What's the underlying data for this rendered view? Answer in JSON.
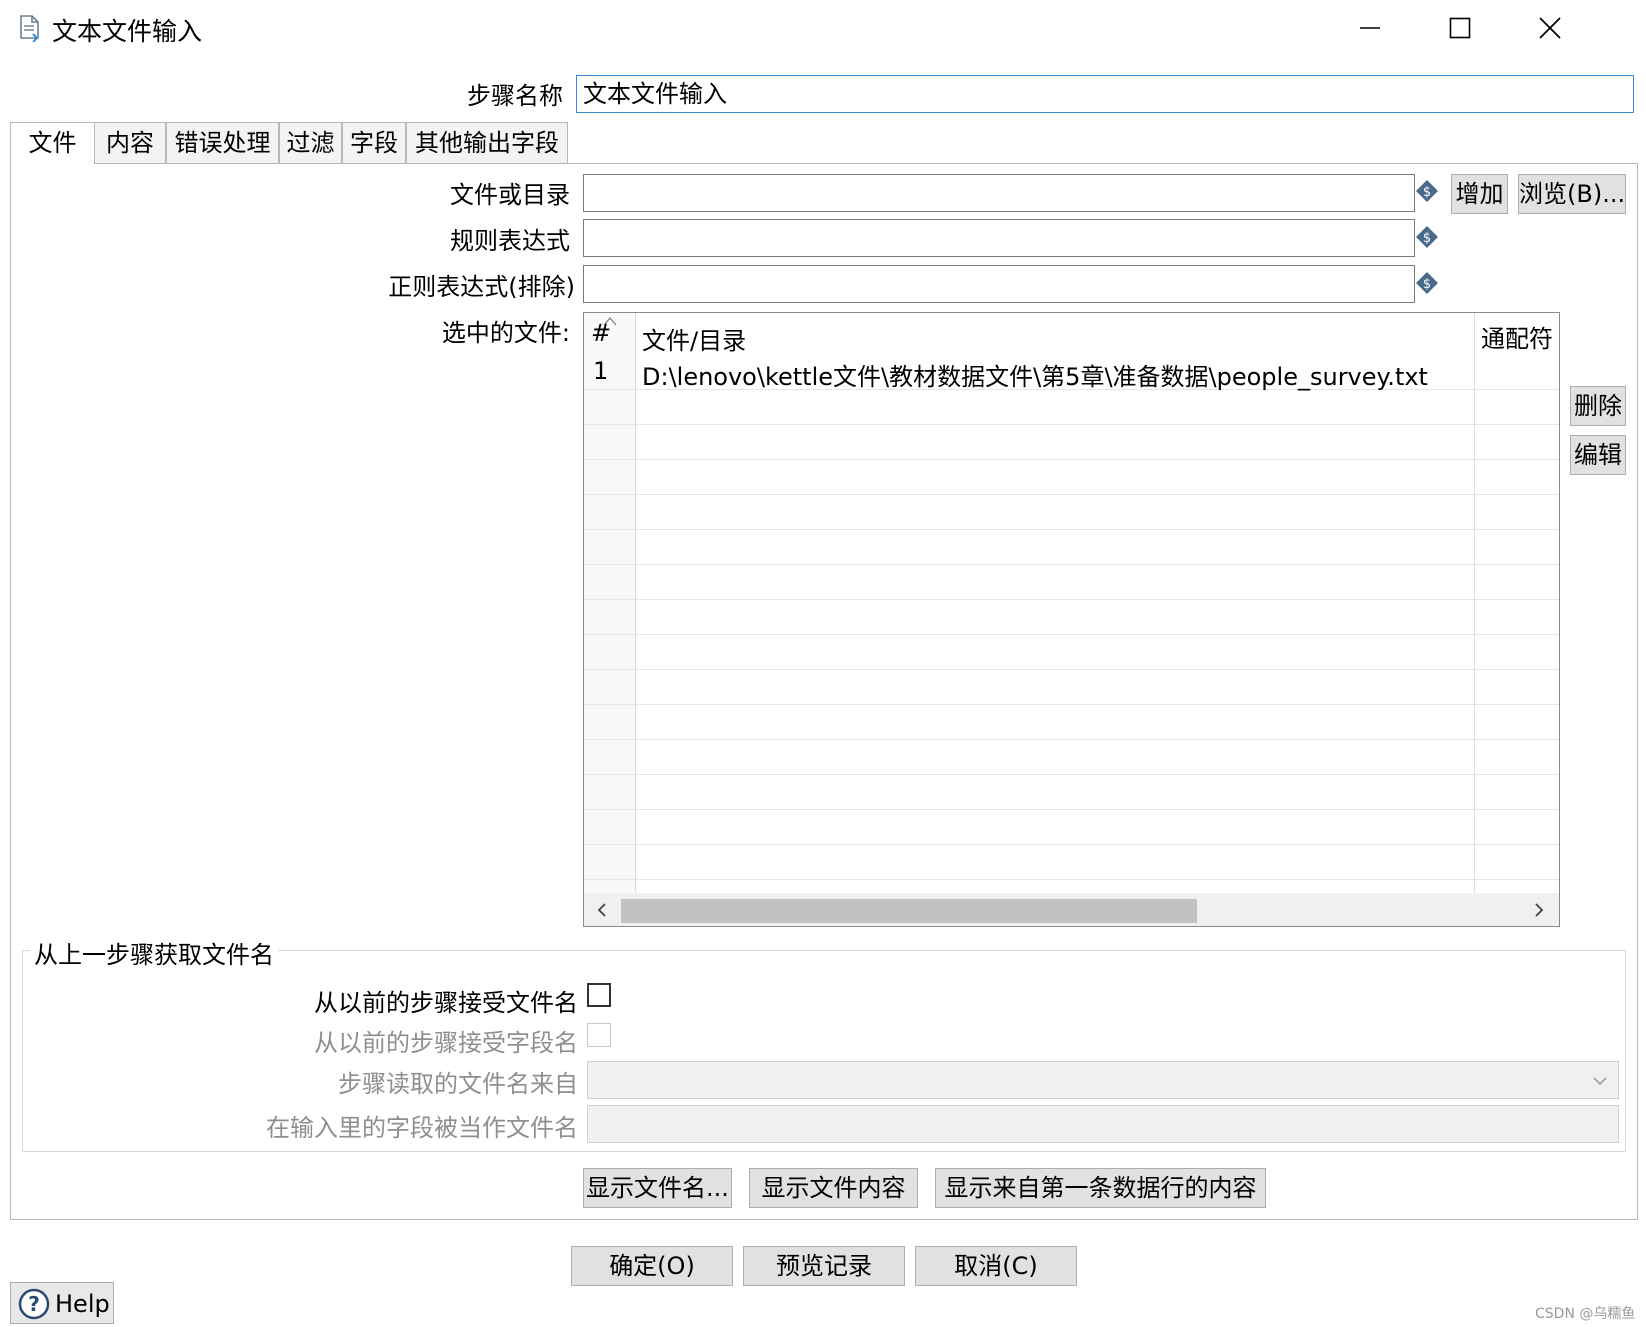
{
  "window": {
    "title": "文本文件输入",
    "minimize_icon": "minimize-icon",
    "maximize_icon": "maximize-icon",
    "close_icon": "close-icon"
  },
  "step_name": {
    "label": "步骤名称",
    "value": "文本文件输入"
  },
  "tabs": [
    {
      "label": "文件",
      "active": true
    },
    {
      "label": "内容",
      "active": false
    },
    {
      "label": "错误处理",
      "active": false
    },
    {
      "label": "过滤",
      "active": false
    },
    {
      "label": "字段",
      "active": false
    },
    {
      "label": "其他输出字段",
      "active": false
    }
  ],
  "file_tab": {
    "file_or_dir_label": "文件或目录",
    "file_or_dir_value": "",
    "regex_label": "规则表达式",
    "regex_value": "",
    "regex_exclude_label": "正则表达式(排除)",
    "regex_exclude_value": "",
    "add_button": "增加",
    "browse_button": "浏览(B)...",
    "selected_files_label": "选中的文件:",
    "delete_button": "删除",
    "edit_button": "编辑",
    "table": {
      "columns": [
        "#",
        "文件/目录",
        "通配符"
      ],
      "rows": [
        {
          "num": "1",
          "path": "D:\\lenovo\\kettle文件\\教材数据文件\\第5章\\准备数据\\people_survey.txt",
          "wildcard": ""
        }
      ],
      "scroll_left_icon": "chevron-left-icon",
      "scroll_right_icon": "chevron-right-icon"
    },
    "from_previous": {
      "group_title": "从上一步骤获取文件名",
      "accept_filenames_label": "从以前的步骤接受文件名",
      "accept_filenames_checked": false,
      "accept_fieldname_label": "从以前的步骤接受字段名",
      "accept_fieldname_checked": false,
      "step_read_from_label": "步骤读取的文件名来自",
      "step_read_from_value": "",
      "field_as_filename_label": "在输入里的字段被当作文件名",
      "field_as_filename_value": ""
    },
    "show_filenames_button": "显示文件名...",
    "show_content_button": "显示文件内容",
    "show_first_row_button": "显示来自第一条数据行的内容"
  },
  "footer": {
    "ok_button": "确定(O)",
    "preview_button": "预览记录",
    "cancel_button": "取消(C)",
    "help_button": "Help",
    "watermark": "CSDN @乌糯鱼"
  },
  "colors": {
    "accent_border": "#3b8ad8",
    "variable_icon": "#4a6a8a",
    "button_bg": "#e1e1e1"
  }
}
